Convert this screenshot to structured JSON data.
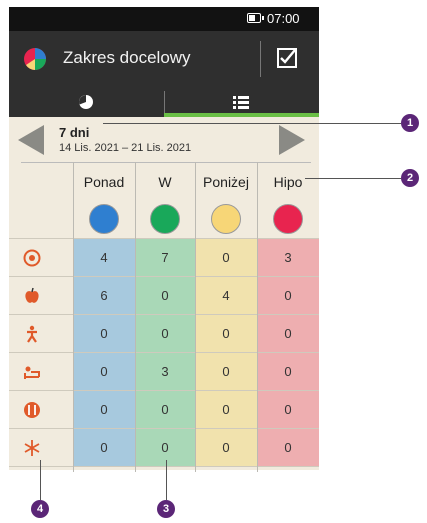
{
  "status": {
    "time": "07:00"
  },
  "app": {
    "title": "Zakres docelowy"
  },
  "period": {
    "label": "7 dni",
    "range": "14 Lis. 2021 – 21 Lis. 2021"
  },
  "columns": [
    {
      "label": "Ponad",
      "dot": "#2f7fd0",
      "bg": "#a7c9de"
    },
    {
      "label": "W",
      "dot": "#19a85a",
      "bg": "#a9d8b7"
    },
    {
      "label": "Poniżej",
      "dot": "#f7d677",
      "bg": "#f1e2ad"
    },
    {
      "label": "Hipo",
      "dot": "#e8244f",
      "bg": "#eeaeb0"
    }
  ],
  "rows": [
    {
      "icon": "before-meal-icon",
      "values": [
        "4",
        "7",
        "0",
        "3"
      ]
    },
    {
      "icon": "apple-icon",
      "values": [
        "6",
        "0",
        "4",
        "0"
      ]
    },
    {
      "icon": "exercise-icon",
      "values": [
        "0",
        "0",
        "0",
        "0"
      ]
    },
    {
      "icon": "sleep-icon",
      "values": [
        "0",
        "3",
        "0",
        "0"
      ]
    },
    {
      "icon": "restaurant-icon",
      "values": [
        "0",
        "0",
        "0",
        "0"
      ]
    },
    {
      "icon": "snowflake-icon",
      "values": [
        "0",
        "0",
        "0",
        "0"
      ]
    }
  ],
  "callouts": [
    "1",
    "2",
    "3",
    "4"
  ]
}
